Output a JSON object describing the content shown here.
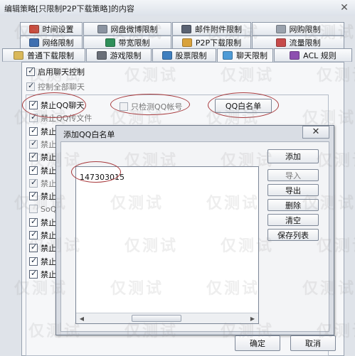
{
  "window": {
    "title": "编辑策略[只限制P2P下载策略]的内容"
  },
  "tabs_row1": [
    {
      "label": "时间设置",
      "icon": "clock-icon",
      "color": "#c94b3c"
    },
    {
      "label": "网盘微博限制",
      "icon": "cloud-disk-icon",
      "color": "#8a93a0"
    },
    {
      "label": "邮件附件限制",
      "icon": "mail-icon",
      "color": "#5a6272"
    },
    {
      "label": "网购限制",
      "icon": "shopping-icon",
      "color": "#9aa2ad"
    }
  ],
  "tabs_row2": [
    {
      "label": "网络限制",
      "icon": "network-icon",
      "color": "#3f6fb0"
    },
    {
      "label": "带宽限制",
      "icon": "bandwidth-icon",
      "color": "#2f8f5a"
    },
    {
      "label": "P2P下载限制",
      "icon": "p2p-icon",
      "color": "#d9a23c"
    },
    {
      "label": "流量限制",
      "icon": "traffic-icon",
      "color": "#c64a4a"
    }
  ],
  "tabs_row3": [
    {
      "label": "普通下载限制",
      "icon": "download-icon",
      "color": "#d9b85a"
    },
    {
      "label": "游戏限制",
      "icon": "game-icon",
      "color": "#6a6f78"
    },
    {
      "label": "股票限制",
      "icon": "stock-icon",
      "color": "#3f7fbf"
    },
    {
      "label": "聊天限制",
      "icon": "chat-icon",
      "color": "#4f9bd6"
    },
    {
      "label": "ACL 规则",
      "icon": "acl-icon",
      "color": "#8d4fb0"
    }
  ],
  "chat": {
    "enable_label": "启用聊天控制",
    "control_all_label": "控制全部聊天",
    "only_detect_label": "只检测QQ帐号",
    "qq_whitelist_button": "QQ白名单",
    "items": [
      {
        "label": "禁止QQ聊天",
        "checked": true,
        "dim": false
      },
      {
        "label": "禁止QQ传文件",
        "checked": true,
        "dim": true
      },
      {
        "label": "禁止M",
        "checked": true,
        "dim": false
      },
      {
        "label": "禁止M",
        "checked": true,
        "dim": true
      },
      {
        "label": "禁止阿",
        "checked": true,
        "dim": false
      },
      {
        "label": "禁止阿",
        "checked": true,
        "dim": false
      },
      {
        "label": "禁止阿",
        "checked": true,
        "dim": true
      },
      {
        "label": "禁止S",
        "checked": true,
        "dim": false
      },
      {
        "label": "SoQ聊",
        "checked": false,
        "dim": true
      },
      {
        "label": "禁止F",
        "checked": true,
        "dim": false
      },
      {
        "label": "禁止阿",
        "checked": true,
        "dim": false
      },
      {
        "label": "禁止液",
        "checked": true,
        "dim": false
      },
      {
        "label": "禁止飞",
        "checked": true,
        "dim": false
      },
      {
        "label": "禁止飞",
        "checked": true,
        "dim": false
      }
    ]
  },
  "dialog": {
    "title": "添加QQ白名单",
    "close_glyph": "✕",
    "list_items": [
      "147303015"
    ],
    "buttons": {
      "add": "添加",
      "import": "导入",
      "export": "导出",
      "delete": "删除",
      "clear": "清空",
      "save_list": "保存列表"
    }
  },
  "footer": {
    "ok": "确定",
    "cancel": "取消"
  },
  "watermark_text": "仅测试"
}
